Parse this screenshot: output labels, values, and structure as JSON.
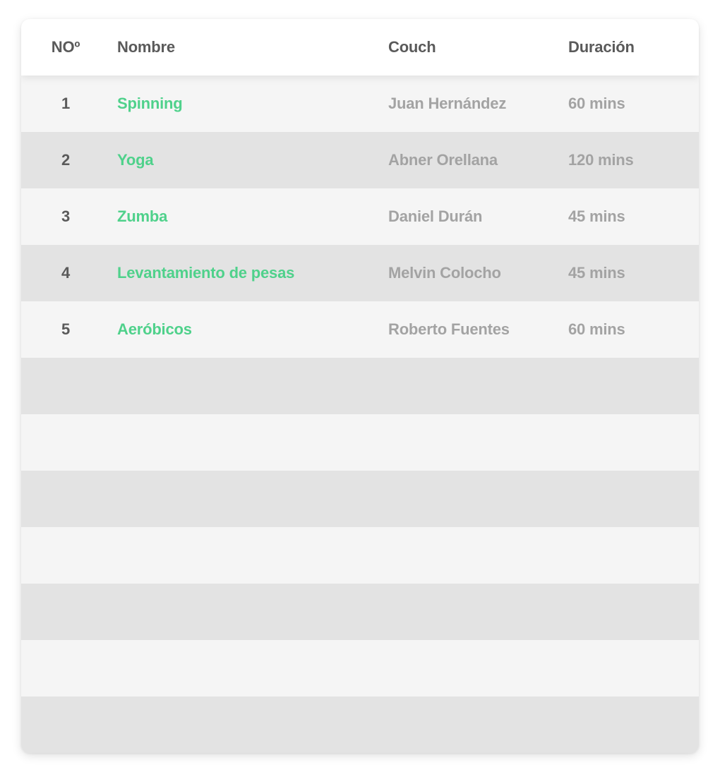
{
  "table": {
    "headers": {
      "no": "NOº",
      "name": "Nombre",
      "coach": "Couch",
      "duration": "Duración"
    },
    "rows": [
      {
        "no": "1",
        "name": "Spinning",
        "coach": "Juan Hernández",
        "duration": "60 mins"
      },
      {
        "no": "2",
        "name": "Yoga",
        "coach": "Abner Orellana",
        "duration": "120 mins"
      },
      {
        "no": "3",
        "name": "Zumba",
        "coach": "Daniel Durán",
        "duration": "45 mins"
      },
      {
        "no": "4",
        "name": "Levantamiento de pesas",
        "coach": "Melvin Colocho",
        "duration": "45 mins"
      },
      {
        "no": "5",
        "name": "Aeróbicos",
        "coach": "Roberto Fuentes",
        "duration": "60 mins"
      }
    ],
    "empty_rows": 7
  },
  "colors": {
    "accent": "#4fd18b",
    "header_text": "#5a5a5a",
    "muted_text": "#a3a3a3",
    "row_light": "#f5f5f5",
    "row_dark": "#e3e3e3"
  }
}
